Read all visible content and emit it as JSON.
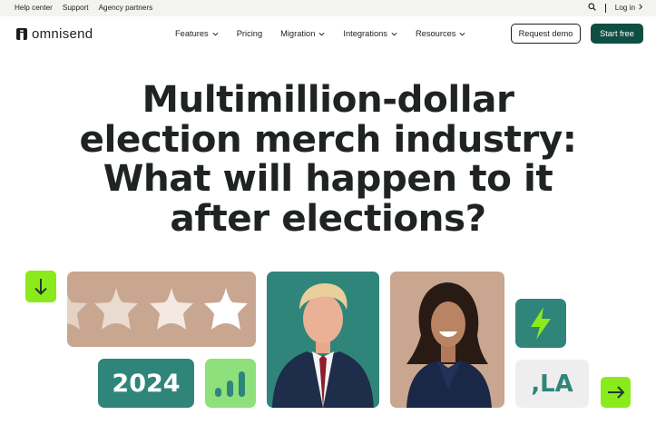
{
  "topbar": {
    "links": [
      "Help center",
      "Support",
      "Agency partners"
    ],
    "login_label": "Log in"
  },
  "nav": {
    "brand": "omnisend",
    "menu": [
      {
        "label": "Features",
        "has_dropdown": true
      },
      {
        "label": "Pricing",
        "has_dropdown": false
      },
      {
        "label": "Migration",
        "has_dropdown": true
      },
      {
        "label": "Integrations",
        "has_dropdown": true
      },
      {
        "label": "Resources",
        "has_dropdown": true
      }
    ],
    "demo_label": "Request demo",
    "start_label": "Start free"
  },
  "hero": {
    "title_lines": [
      "Multimillion-dollar",
      "election merch industry:",
      "What will happen to it",
      "after elections?"
    ]
  },
  "tiles": {
    "year_text": "2024",
    "la_text": ",LA"
  },
  "icons": {
    "search": "search-icon",
    "login_chevron": "chevron-right-icon",
    "menu_chevron": "chevron-down-icon",
    "down": "arrow-down-icon",
    "next": "arrow-right-icon",
    "bolt": "lightning-icon",
    "chart": "bar-chart-icon",
    "stars": "star-icon"
  },
  "colors": {
    "brand_dark_green": "#0f4e42",
    "teal": "#2f8579",
    "lime": "#8aea1c",
    "light_green": "#8de07a",
    "tan": "#c9a690",
    "topbar_bg": "#f3f3f1"
  }
}
